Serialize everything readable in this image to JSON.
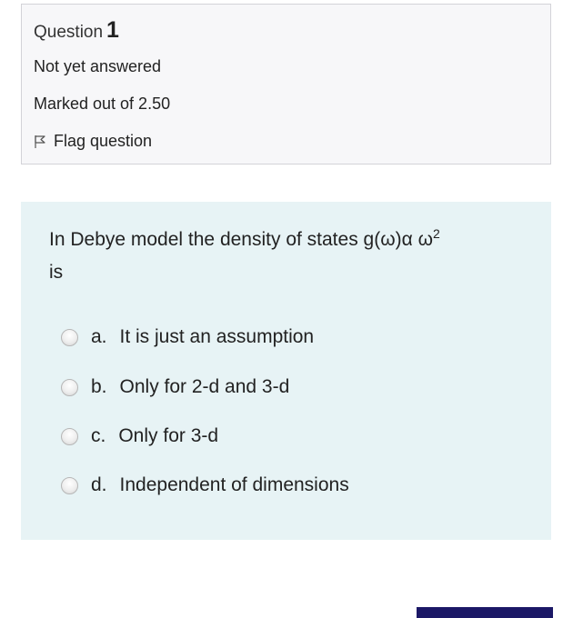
{
  "info": {
    "question_label": "Question",
    "question_number": "1",
    "state": "Not yet answered",
    "grade": "Marked out of 2.50",
    "flag_label": "Flag question"
  },
  "question": {
    "text_part1": "In Debye model the density of states g(ω)α ω",
    "superscript": "2",
    "text_part2": "is",
    "answers": [
      {
        "letter": "a.",
        "text": "It is just an assumption"
      },
      {
        "letter": "b.",
        "text": "Only for 2-d and 3-d"
      },
      {
        "letter": "c.",
        "text": "Only for 3-d"
      },
      {
        "letter": "d.",
        "text": "Independent of dimensions"
      }
    ]
  },
  "colors": {
    "info_bg": "#f7f7f9",
    "content_bg": "#e7f3f5",
    "button_accent": "#1b1866"
  }
}
